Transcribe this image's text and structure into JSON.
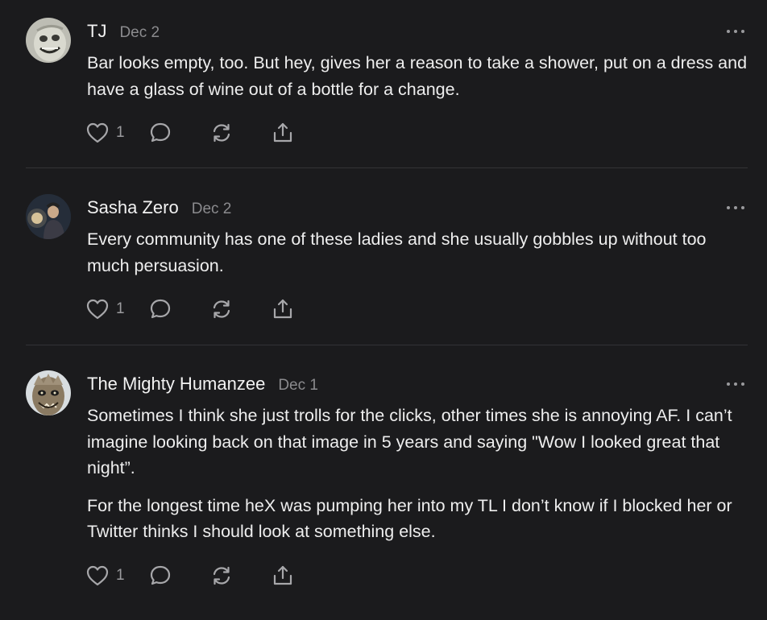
{
  "comments": [
    {
      "author": "TJ",
      "date": "Dec 2",
      "paragraphs": [
        "Bar looks empty, too. But hey, gives her a reason to take a shower, put on a dress and have a glass of wine out of a bottle for a change."
      ],
      "like_count": "1",
      "avatar_icon": "cartoon-face-avatar"
    },
    {
      "author": "Sasha Zero",
      "date": "Dec 2",
      "paragraphs": [
        "Every community has one of these ladies and she usually gobbles up without too much persuasion."
      ],
      "like_count": "1",
      "avatar_icon": "person-in-dark-room-avatar"
    },
    {
      "author": "The Mighty Humanzee",
      "date": "Dec 1",
      "paragraphs": [
        "Sometimes I think she just trolls for the clicks, other times she is annoying AF. I can’t imagine looking back on that image in 5 years and saying \"Wow I looked great that night”.",
        "For the longest time heX was pumping her into my TL I don’t know if I blocked her or Twitter thinks I should look at something else."
      ],
      "like_count": "1",
      "avatar_icon": "creature-mask-avatar"
    }
  ],
  "icons": {
    "like": "heart-icon",
    "reply": "speech-bubble-icon",
    "restack": "repost-arrows-icon",
    "share": "share-upload-icon",
    "more": "ellipsis-icon"
  },
  "colors": {
    "background": "#1b1b1d",
    "text": "#eeeeee",
    "muted": "#8b8b8e",
    "divider": "#333336"
  }
}
